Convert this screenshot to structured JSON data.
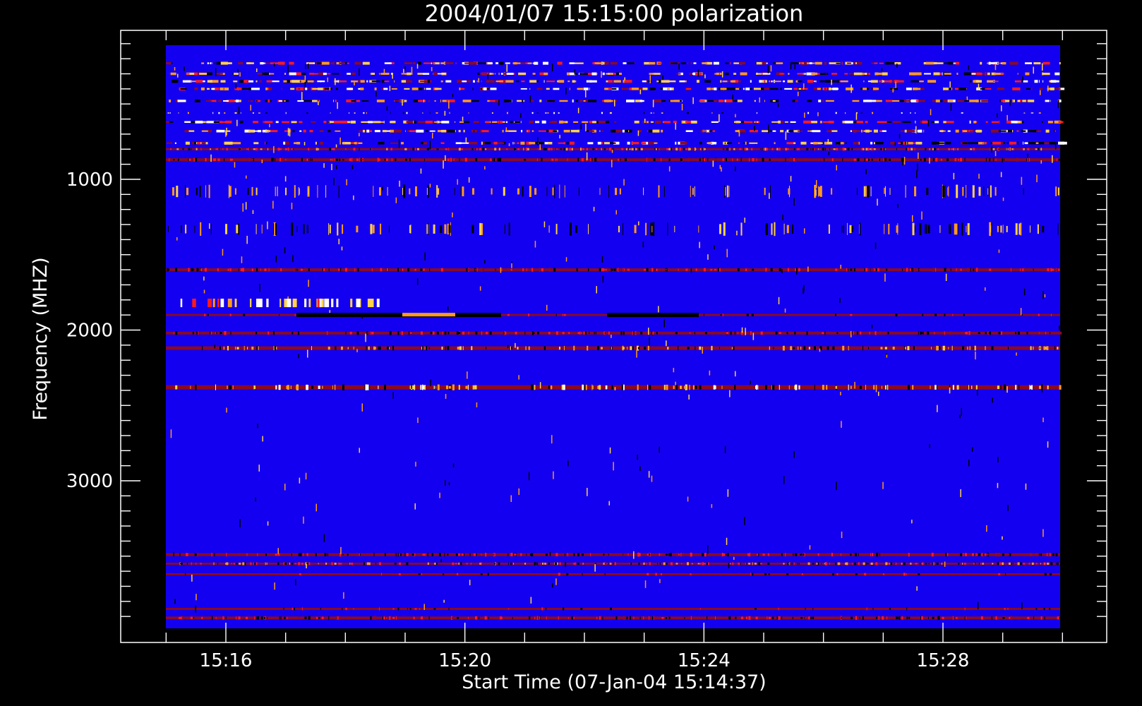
{
  "chart_data": {
    "type": "heatmap",
    "title": "2004/01/07 15:15:00 polarization",
    "xlabel": "Start Time (07-Jan-04 15:14:37)",
    "ylabel": "Frequency (MHZ)",
    "x_ticks": [
      "15:16",
      "15:20",
      "15:24",
      "15:28"
    ],
    "y_ticks": [
      "1000",
      "2000",
      "3000"
    ],
    "xlim": [
      "15:14:37",
      "15:30:33"
    ],
    "ylim": [
      3950,
      100
    ],
    "y_inverted": true,
    "background_value_color": "#1400f0",
    "palette": {
      "black": "#000000",
      "dark_red": "#8a0a20",
      "red": "#ff1a1a",
      "orange": "#ff9a1a",
      "yellow": "#ffd24a",
      "white": "#ffffff"
    },
    "bands_mhz": [
      {
        "freq": 230,
        "texture": "busy"
      },
      {
        "freq": 300,
        "texture": "busy"
      },
      {
        "freq": 350,
        "texture": "busy"
      },
      {
        "freq": 400,
        "texture": "busy"
      },
      {
        "freq": 480,
        "texture": "busy"
      },
      {
        "freq": 560,
        "texture": "sparse"
      },
      {
        "freq": 620,
        "texture": "busy"
      },
      {
        "freq": 680,
        "texture": "busy"
      },
      {
        "freq": 760,
        "texture": "busy"
      },
      {
        "freq": 800,
        "texture": "dense-orange"
      },
      {
        "freq": 870,
        "texture": "dense-red"
      },
      {
        "freq": 1080,
        "texture": "ticks"
      },
      {
        "freq": 1330,
        "texture": "ticks"
      },
      {
        "freq": 1600,
        "texture": "dense-red"
      },
      {
        "freq": 1900,
        "texture": "line-dark-red"
      },
      {
        "freq": 2020,
        "texture": "dense-red"
      },
      {
        "freq": 2120,
        "texture": "ticks-orange"
      },
      {
        "freq": 2380,
        "texture": "dense-yellow"
      },
      {
        "freq": 3490,
        "texture": "dense-red"
      },
      {
        "freq": 3550,
        "texture": "dense-orange"
      },
      {
        "freq": 3620,
        "texture": "line-dark-red"
      },
      {
        "freq": 3850,
        "texture": "line-dark-red"
      },
      {
        "freq": 3910,
        "texture": "dense-red"
      }
    ]
  }
}
